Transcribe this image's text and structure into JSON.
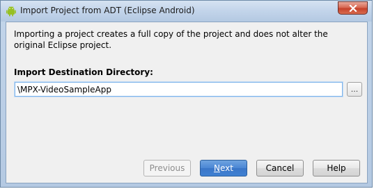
{
  "window": {
    "title": "Import Project from ADT (Eclipse Android)",
    "close_symbol": "✕"
  },
  "main": {
    "description": "Importing a project creates a full copy of the project and does not alter the original Eclipse project.",
    "destination_label": "Import Destination Directory:",
    "destination_value": "\\MPX-VideoSampleApp",
    "browse_label": "..."
  },
  "buttons": {
    "previous": "Previous",
    "next_mnemonic": "N",
    "next_rest": "ext",
    "cancel": "Cancel",
    "help": "Help"
  },
  "icons": {
    "app": "android-icon",
    "close": "close-icon"
  },
  "colors": {
    "primary_button": "#4a86d4",
    "close_button": "#c6422b",
    "android_green": "#97c024"
  }
}
